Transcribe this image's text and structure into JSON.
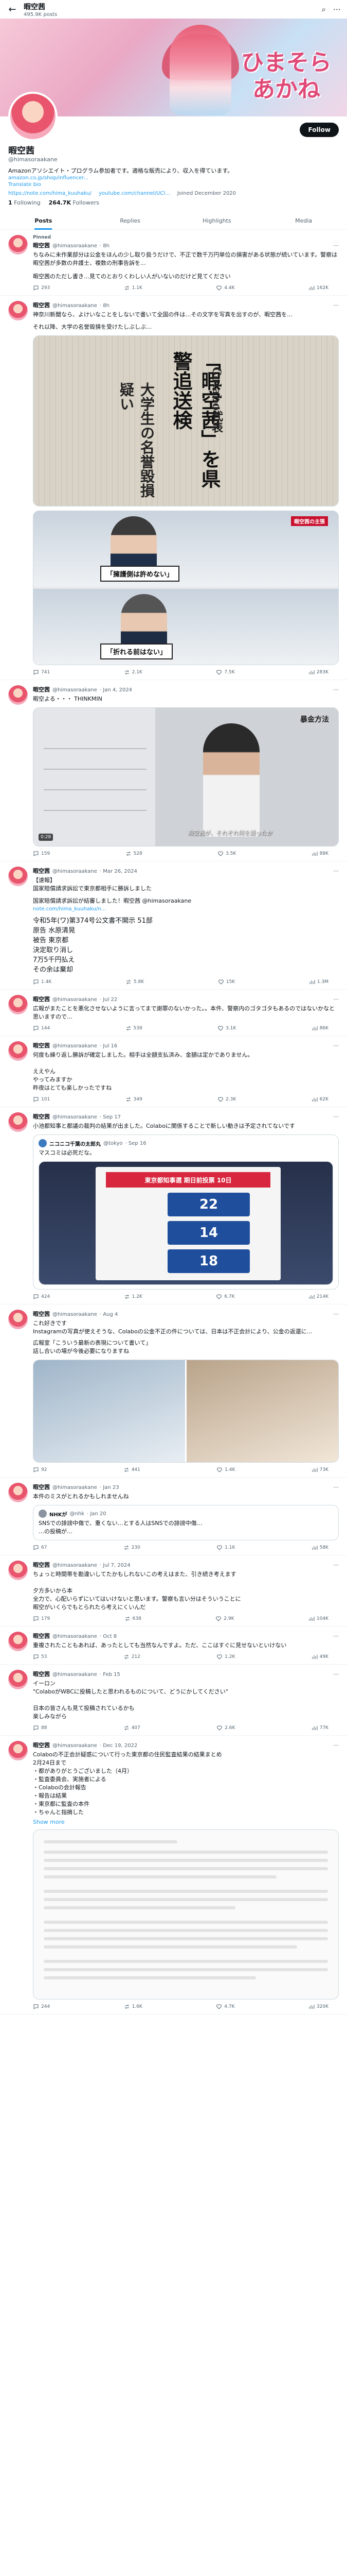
{
  "topbar": {
    "name": "暇空茜",
    "posts_count": "495.9K posts"
  },
  "banner": {
    "title_line1": "ひまそら",
    "title_line2": "あかね"
  },
  "profile": {
    "name": "暇空茜",
    "handle": "@himasoraakane",
    "follow_label": "Follow",
    "bio": "Amazonアソシエイト・プログラム参加者です。適格な販売により、収入を得ています。",
    "link1": "amazon.co.jp/shop/influencer...",
    "translate": "Translate bio",
    "website": "https://note.com/hima_kuuhaku/",
    "youtube": "youtube.com/channel/UCl...",
    "joined": "Joined December 2020",
    "following_count": "1",
    "following_label": "Following",
    "followers_count": "264.7K",
    "followers_label": "Followers"
  },
  "tabs": [
    "Posts",
    "Replies",
    "Highlights",
    "Media"
  ],
  "tweets": [
    {
      "pinned": "Pinned",
      "name": "暇空茜",
      "handle": "@himasoraakane",
      "date": "· 8h",
      "text": "ちなみに未作業部分は公金をほんの少し取り扱うだけで、不正で数千万円単位の損害がある状態が続いています。警察は暇空茜が多数の弁護士、複数の刑事告訴を...",
      "text2": "暇空茜のただし書き…見てのとおりくわしい人がいないのだけど見てください",
      "actions": [
        "293",
        "1.1K",
        "4.4K",
        "162K"
      ]
    },
    {
      "name": "暇空茜",
      "handle": "@himasoraakane",
      "date": "· 8h",
      "text": "神奈川新聞なら、よけいなことをしないで書いて全国の件は…その文字を写真を出すのが、暇空茜を…",
      "text2": "それ以降、大学の名誉毀損を受けたしぶしぶ…",
      "news_hl1": "「暇空茜」を県警追送検",
      "news_hl2": "Colabo代表",
      "news_hl3": "大学生の名誉毀損疑い",
      "tv_caption1": "「擁護側は許めない」",
      "tv_tag1": "暇空茜の主張",
      "tv_caption2": "「折れる前はない」",
      "actions": [
        "741",
        "2.1K",
        "7.5K",
        "283K"
      ]
    },
    {
      "name": "暇空茜",
      "handle": "@himasoraakane",
      "date": "· Jan 4, 2024",
      "text": "暇空よる・・・ THINKMIN",
      "video_title": "暴金方法",
      "video_sub": "暇空茜が、それぞれ何を語ったか",
      "video_time": "0:28",
      "actions": [
        "159",
        "528",
        "3.5K",
        "88K"
      ]
    },
    {
      "name": "暇空茜",
      "handle": "@himasoraakane",
      "date": "· Mar 26, 2024",
      "text": "【速報】\n国家賠償請求訴訟で東京都相手に勝訴しました",
      "text2": "国家賠償請求訴訟が結審しました！暇空茜 @himasoraakane",
      "link": "note.com/hima_kuuhaku/n...",
      "text3": "令和5年(ワ)第374号公文書不開示  51部\n原告  水原清晃\n被告  東京都\n決定取り消し\n7万5千円払え\nその余は棄却",
      "actions": [
        "1.4K",
        "5.8K",
        "15K",
        "1.3M"
      ]
    },
    {
      "name": "暇空茜",
      "handle": "@himasoraakane",
      "date": "· Jul 22",
      "text": "広報がまたことを悪化させないように言ってまで謝罪のないかった。。本件、警察内のゴタゴタもあるのではないかなと思いますので…",
      "actions": [
        "144",
        "538",
        "3.1K",
        "86K"
      ]
    },
    {
      "name": "暇空茜",
      "handle": "@himasoraakane",
      "date": "· Jul 16",
      "text": "何度も繰り返し勝訴が確定しました。相手は全額支払済み、金額は定かでありません。\n\nええやん\nやってみますか\n昨夜はとても楽しかったですね",
      "actions": [
        "101",
        "349",
        "2.3K",
        "62K"
      ]
    },
    {
      "name": "暇空茜",
      "handle": "@himasoraakane",
      "date": "· Sep 17",
      "text": "小池都知事と都議の裁判の結果が出ました。Colaboに関係することで新しい動きは予定されてないです",
      "quote_name": "ニコニコ千葉の太郎丸",
      "quote_handle": "@tokyo",
      "quote_date": "· Sep 16",
      "quote_text": "マスコミは必死だな。",
      "board_head": "東京都知事選 期日前投票 10日",
      "board_val1": "22",
      "board_val2": "14",
      "board_val3": "18",
      "actions": [
        "424",
        "1.2K",
        "6.7K",
        "214K"
      ]
    },
    {
      "name": "暇空茜",
      "handle": "@himasoraakane",
      "date": "· Aug 4",
      "text": "これ好きです\nInstagramの写真が使えそうな、Colaboの公金不正の件については、日本は不正会計により、公金の返還に...",
      "text2": "広報室「こういう最新の表現について書いて」\n話し合いの場が今後必要になりますね",
      "actions": [
        "92",
        "441",
        "1.4K",
        "73K"
      ]
    },
    {
      "name": "暇空茜",
      "handle": "@himasoraakane",
      "date": "· Jan 23",
      "text": "本件のミスがとれるかもしれませんね",
      "quote_name": "NHKが",
      "quote_handle": "@nhk",
      "quote_date": "· Jan 20",
      "quote_text": "SNSでの誹謗中傷で、重くない…とする人はSNSでの誹謗中傷…\n…の投稿が…",
      "actions": [
        "67",
        "230",
        "1.1K",
        "58K"
      ]
    },
    {
      "name": "暇空茜",
      "handle": "@himasoraakane",
      "date": "· Jul 7, 2024",
      "text": "ちょっと時間帯を勘違いしてたかもしれないこの考えはまた、引き続き考えます\n\n夕方多いから本\n全力で、心配いらずにいてはいけないと思います。警察も言い分はそういうことに\n暇空がいくらでもとられたら考えにくいんだ",
      "actions": [
        "179",
        "638",
        "2.9K",
        "104K"
      ]
    },
    {
      "name": "暇空茜",
      "handle": "@himasoraakane",
      "date": "· Oct 8",
      "text": "重複されたこともあれば、あったとしても当然なんですよ。ただ、ここはすぐに見せないといけない",
      "actions": [
        "53",
        "212",
        "1.2K",
        "49K"
      ]
    },
    {
      "name": "暇空茜",
      "handle": "@himasoraakane",
      "date": "· Feb 15",
      "text": "イーロン\n\"ColaboがWBCに投稿したと思われるものについて、どうにかしてください\"\n\n日本の皆さんも見て投稿されているかも\n楽しみながら",
      "actions": [
        "88",
        "407",
        "2.6K",
        "77K"
      ]
    },
    {
      "name": "暇空茜",
      "handle": "@himasoraakane",
      "date": "· Dec 19, 2022",
      "text": "Colaboの不正会計疑惑について行った東京都の住民監査結果の結果まとめ\n2月24日まで\n・都がありがとうございました（4月）\n・監査委員会、実施者による\n・Colaboの会計報告\n・報告は結果\n・東京都に監査の本件\n・ちゃんと指摘した",
      "show_more": "Show more",
      "actions": [
        "244",
        "1.6K",
        "4.7K",
        "320K"
      ]
    }
  ],
  "colors": {
    "accent": "#1d9bf0",
    "text": "#0f1419",
    "muted": "#536471",
    "border": "#eff3f4"
  },
  "icons": [
    "back-arrow-icon",
    "search-icon",
    "more-icon",
    "reply-icon",
    "repost-icon",
    "like-icon",
    "views-icon"
  ]
}
